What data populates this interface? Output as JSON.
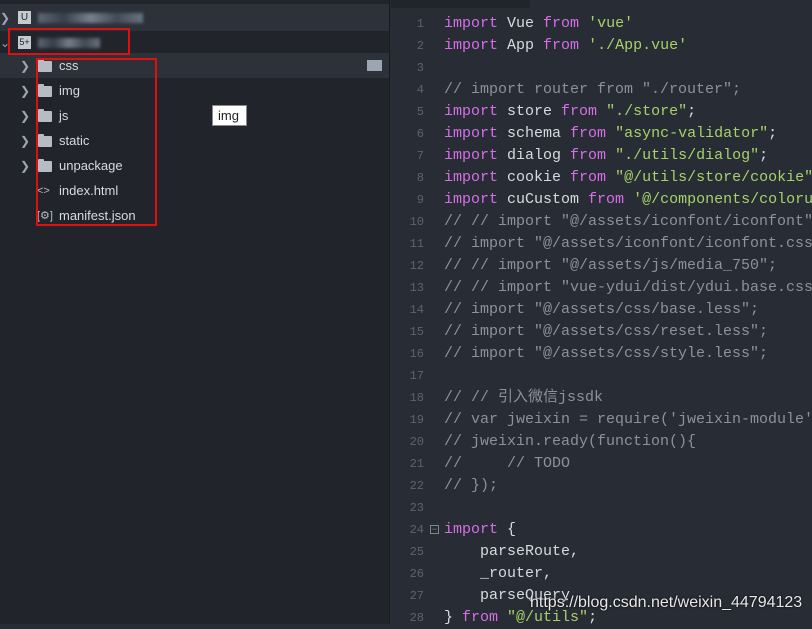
{
  "sidebar": {
    "projects": [
      {
        "badge": "U",
        "name_blurred": true,
        "expanded": false
      },
      {
        "badge": "5+",
        "name_blurred": true,
        "expanded": true
      }
    ],
    "items": [
      {
        "label": "css",
        "icon": "folder-icon"
      },
      {
        "label": "img",
        "icon": "folder-icon"
      },
      {
        "label": "js",
        "icon": "folder-icon"
      },
      {
        "label": "static",
        "icon": "folder-icon"
      },
      {
        "label": "unpackage",
        "icon": "folder-icon"
      },
      {
        "label": "index.html",
        "icon": "code-file-icon",
        "glyph": "<>"
      },
      {
        "label": "manifest.json",
        "icon": "settings-file-icon",
        "glyph": "[⚙]"
      }
    ],
    "tooltip": "img"
  },
  "editor": {
    "colors": {
      "keyword": "#d66ee8",
      "string": "#a7d26b",
      "comment": "#8b929c"
    },
    "lines": [
      [
        [
          "kw",
          "import"
        ],
        [
          "id",
          " Vue "
        ],
        [
          "kw",
          "from"
        ],
        [
          "id",
          " "
        ],
        [
          "str",
          "'vue'"
        ]
      ],
      [
        [
          "kw",
          "import"
        ],
        [
          "id",
          " App "
        ],
        [
          "kw",
          "from"
        ],
        [
          "id",
          " "
        ],
        [
          "str",
          "'./App.vue'"
        ]
      ],
      [],
      [
        [
          "cm",
          "// import router from \"./router\";"
        ]
      ],
      [
        [
          "kw",
          "import"
        ],
        [
          "id",
          " store "
        ],
        [
          "kw",
          "from"
        ],
        [
          "id",
          " "
        ],
        [
          "str",
          "\"./store\""
        ],
        [
          "id",
          ";"
        ]
      ],
      [
        [
          "kw",
          "import"
        ],
        [
          "id",
          " schema "
        ],
        [
          "kw",
          "from"
        ],
        [
          "id",
          " "
        ],
        [
          "str",
          "\"async-validator\""
        ],
        [
          "id",
          ";"
        ]
      ],
      [
        [
          "kw",
          "import"
        ],
        [
          "id",
          " dialog "
        ],
        [
          "kw",
          "from"
        ],
        [
          "id",
          " "
        ],
        [
          "str",
          "\"./utils/dialog\""
        ],
        [
          "id",
          ";"
        ]
      ],
      [
        [
          "kw",
          "import"
        ],
        [
          "id",
          " cookie "
        ],
        [
          "kw",
          "from"
        ],
        [
          "id",
          " "
        ],
        [
          "str",
          "\"@/utils/store/cookie\""
        ]
      ],
      [
        [
          "kw",
          "import"
        ],
        [
          "id",
          " cuCustom "
        ],
        [
          "kw",
          "from"
        ],
        [
          "id",
          " "
        ],
        [
          "str",
          "'@/components/coloru"
        ]
      ],
      [
        [
          "cm",
          "// // import \"@/assets/iconfont/iconfont\""
        ]
      ],
      [
        [
          "cm",
          "// import \"@/assets/iconfont/iconfont.css"
        ]
      ],
      [
        [
          "cm",
          "// // import \"@/assets/js/media_750\";"
        ]
      ],
      [
        [
          "cm",
          "// // import \"vue-ydui/dist/ydui.base.css"
        ]
      ],
      [
        [
          "cm",
          "// import \"@/assets/css/base.less\";"
        ]
      ],
      [
        [
          "cm",
          "// import \"@/assets/css/reset.less\";"
        ]
      ],
      [
        [
          "cm",
          "// import \"@/assets/css/style.less\";"
        ]
      ],
      [],
      [
        [
          "cm",
          "// // 引入微信jssdk"
        ]
      ],
      [
        [
          "cm",
          "// var jweixin = require('jweixin-module'"
        ]
      ],
      [
        [
          "cm",
          "// jweixin.ready(function(){"
        ]
      ],
      [
        [
          "cm",
          "//     // TODO"
        ]
      ],
      [
        [
          "cm",
          "// });"
        ]
      ],
      [],
      [
        [
          "kw",
          "import"
        ],
        [
          "id",
          " {"
        ]
      ],
      [
        [
          "id",
          "    parseRoute,"
        ]
      ],
      [
        [
          "id",
          "    _router,"
        ]
      ],
      [
        [
          "id",
          "    parseQuery"
        ]
      ],
      [
        [
          "id",
          "} "
        ],
        [
          "kw",
          "from"
        ],
        [
          "id",
          " "
        ],
        [
          "str",
          "\"@/utils\""
        ],
        [
          "id",
          ";"
        ]
      ]
    ]
  },
  "watermark": "https://blog.csdn.net/weixin_44794123"
}
